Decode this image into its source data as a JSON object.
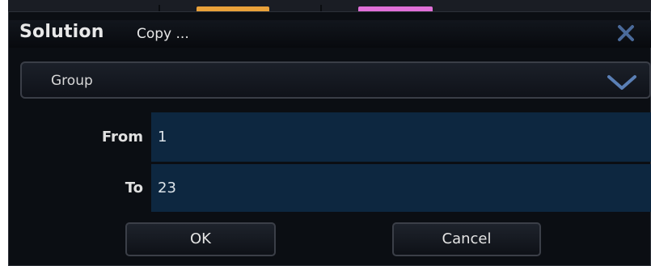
{
  "dialog": {
    "logo_text": "Solution",
    "title": "Copy ...",
    "close_icon": "close-icon"
  },
  "group_select": {
    "selected": "Group",
    "icon": "chevron-down-icon"
  },
  "fields": {
    "from_label": "From",
    "from_value": "1",
    "to_label": "To",
    "to_value": "23"
  },
  "buttons": {
    "ok_label": "OK",
    "cancel_label": "Cancel"
  },
  "colors": {
    "tab_orange": "#e8a13a",
    "tab_pink": "#e070d8",
    "input_background": "#0d2740",
    "close_icon": "#4a6a9a"
  }
}
